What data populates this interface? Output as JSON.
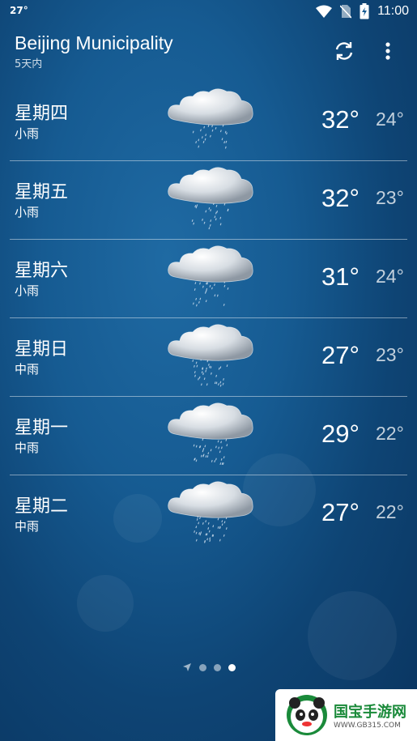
{
  "status": {
    "temp": "27°",
    "time": "11:00"
  },
  "header": {
    "city": "Beijing Municipality",
    "subtitle": "5天内"
  },
  "forecast": [
    {
      "day": "星期四",
      "condition": "小雨",
      "high": "32°",
      "low": "24°",
      "icon": "light-rain-icon"
    },
    {
      "day": "星期五",
      "condition": "小雨",
      "high": "32°",
      "low": "23°",
      "icon": "light-rain-icon"
    },
    {
      "day": "星期六",
      "condition": "小雨",
      "high": "31°",
      "low": "24°",
      "icon": "light-rain-icon"
    },
    {
      "day": "星期日",
      "condition": "中雨",
      "high": "27°",
      "low": "23°",
      "icon": "moderate-rain-icon"
    },
    {
      "day": "星期一",
      "condition": "中雨",
      "high": "29°",
      "low": "22°",
      "icon": "moderate-rain-icon"
    },
    {
      "day": "星期二",
      "condition": "中雨",
      "high": "27°",
      "low": "22°",
      "icon": "moderate-rain-icon"
    }
  ],
  "pager": {
    "pages": 3,
    "active": 3
  },
  "watermark": {
    "title": "国宝手游网",
    "url": "WWW.GB315.COM"
  },
  "colors": {
    "background": "#165b92",
    "divider": "rgba(255,255,255,0.45)",
    "watermark_green": "#1a8a3a"
  }
}
